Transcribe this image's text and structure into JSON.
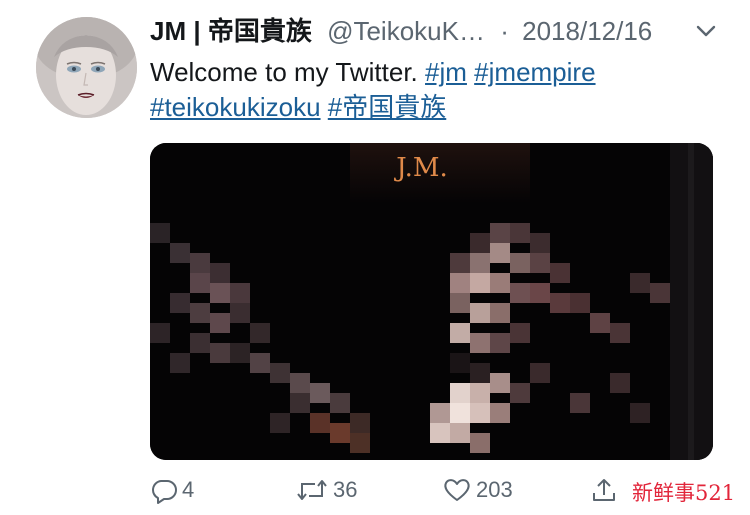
{
  "tweet": {
    "display_name": "JM | 帝国貴族",
    "handle": "@TeikokuK…",
    "separator": "·",
    "date": "2018/12/16",
    "text_prefix": "Welcome to my Twitter.",
    "hashtags": [
      "#jm",
      "#jmempire",
      "#teikokukizoku",
      "#帝国貴族"
    ],
    "media": {
      "sign_text": "J.M."
    },
    "actions": {
      "reply_count": "4",
      "retweet_count": "36",
      "like_count": "203"
    }
  },
  "watermark": "新鲜事521",
  "colors": {
    "link": "#1b5e96",
    "secondary_text": "#5b6670",
    "watermark": "#e2253a",
    "media_background": "#050405"
  },
  "icons": {
    "reply": "reply-icon",
    "retweet": "retweet-icon",
    "like": "heart-icon",
    "share": "share-icon",
    "caret": "chevron-down-icon"
  }
}
